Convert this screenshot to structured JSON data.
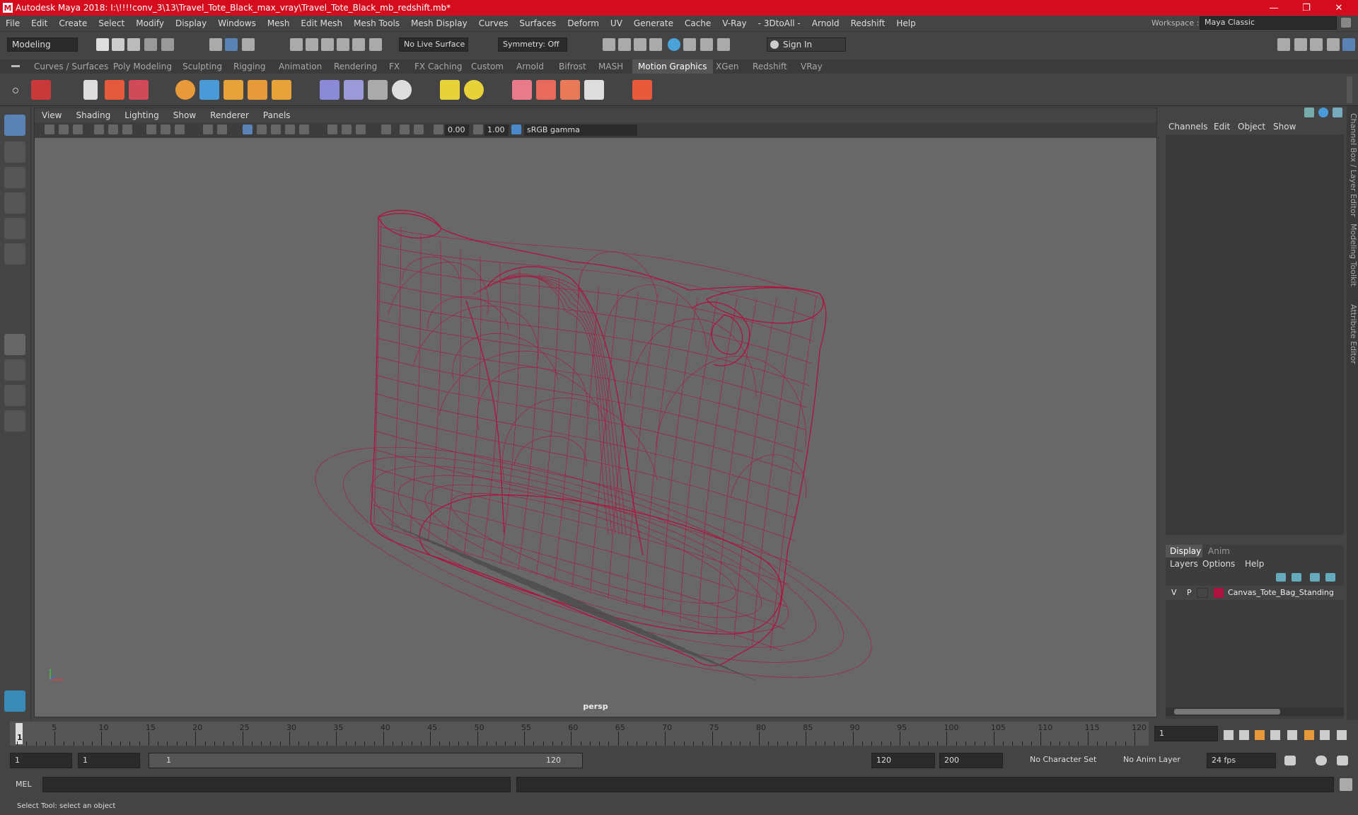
{
  "window": {
    "title": "Autodesk Maya 2018: I:\\!!!!conv_3\\13\\Travel_Tote_Black_max_vray\\Travel_Tote_Black_mb_redshift.mb*",
    "minimize": "—",
    "maximize": "❐",
    "close": "✕"
  },
  "menubar": {
    "items": [
      "File",
      "Edit",
      "Create",
      "Select",
      "Modify",
      "Display",
      "Windows",
      "Mesh",
      "Edit Mesh",
      "Mesh Tools",
      "Mesh Display",
      "Curves",
      "Surfaces",
      "Deform",
      "UV",
      "Generate",
      "Cache",
      "V-Ray",
      "- 3DtoAll -",
      "Arnold",
      "Redshift",
      "Help"
    ],
    "workspace_label": "Workspace :",
    "workspace_value": "Maya Classic"
  },
  "statusline": {
    "mode": "Modeling",
    "live_surface": "No Live Surface",
    "symmetry": "Symmetry: Off",
    "sign_in": "Sign In"
  },
  "shelf": {
    "tabs": [
      "Curves / Surfaces",
      "Poly Modeling",
      "Sculpting",
      "Rigging",
      "Animation",
      "Rendering",
      "FX",
      "FX Caching",
      "Custom",
      "Arnold",
      "Bifrost",
      "MASH",
      "Motion Graphics",
      "XGen",
      "Redshift",
      "VRay"
    ],
    "active_tab": "Motion Graphics"
  },
  "viewport": {
    "menu": [
      "View",
      "Shading",
      "Lighting",
      "Show",
      "Renderer",
      "Panels"
    ],
    "exposure": "0.00",
    "gamma": "1.00",
    "color_space": "sRGB gamma",
    "camera": "persp",
    "wire_color": "#b0123f"
  },
  "channel_box": {
    "tabs": [
      "Channels",
      "Edit",
      "Object",
      "Show"
    ]
  },
  "layer_editor": {
    "tabs": [
      "Display",
      "Anim"
    ],
    "menu": [
      "Layers",
      "Options",
      "Help"
    ],
    "layers": [
      {
        "v": "V",
        "p": "P",
        "color": "#b0123f",
        "name": "Canvas_Tote_Bag_Standing"
      }
    ]
  },
  "side_tabs": [
    "Channel Box / Layer Editor",
    "Modeling Toolkit",
    "Attribute Editor"
  ],
  "timeline": {
    "ticks": [
      "5",
      "10",
      "15",
      "20",
      "25",
      "30",
      "35",
      "40",
      "45",
      "50",
      "55",
      "60",
      "65",
      "70",
      "75",
      "80",
      "85",
      "90",
      "95",
      "100",
      "105",
      "110",
      "115",
      "120"
    ],
    "start_marker": "1",
    "current_frame": "1"
  },
  "range": {
    "start": "1",
    "playback_start": "1",
    "slider_start": "1",
    "slider_end": "120",
    "playback_end": "120",
    "end": "200",
    "character_set": "No Character Set",
    "anim_layer": "No Anim Layer",
    "fps": "24 fps"
  },
  "command_line": {
    "label": "MEL"
  },
  "help_line": "Select Tool: select an object"
}
